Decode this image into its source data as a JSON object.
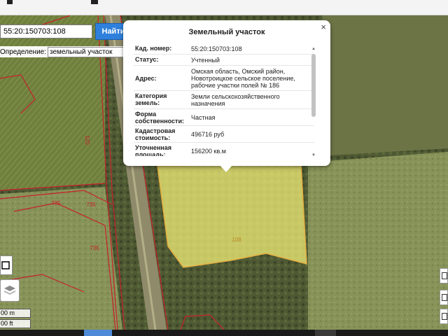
{
  "search": {
    "value": "55:20:150703:108",
    "button_label": "Найти"
  },
  "definition": {
    "label": "Определение:",
    "selected": "земельный участок"
  },
  "popup": {
    "title": "Земельный участок",
    "rows": [
      {
        "key": "Кад. номер:",
        "value": "55:20:150703:108"
      },
      {
        "key": "Статус:",
        "value": "Учтенный"
      },
      {
        "key": "Адрес:",
        "value": "Омская область, Омский район, Новотроицкое сельское поселение, рабочие участки полей № 186"
      },
      {
        "key": "Категория земель:",
        "value": "Земли сельскохозяйственного назначения"
      },
      {
        "key": "Форма собственности:",
        "value": "Частная"
      },
      {
        "key": "Кадастровая стоимость:",
        "value": "496716 руб"
      },
      {
        "key": "Уточненная площадь:",
        "value": "156200 кв.м"
      }
    ]
  },
  "map": {
    "parcel_label": "108",
    "labels": [
      "120",
      "735",
      "735",
      "735"
    ]
  },
  "scale": {
    "metric": "00 m",
    "imperial": "00 ft"
  },
  "icons": {
    "close": "close-icon",
    "layers": "layers-icon",
    "dropdown": "chevron-down-icon"
  },
  "colors": {
    "parcel_fill": "#f2ee78",
    "parcel_stroke": "#e6b040",
    "boundary": "#c8202a",
    "button": "#2f80dc"
  }
}
